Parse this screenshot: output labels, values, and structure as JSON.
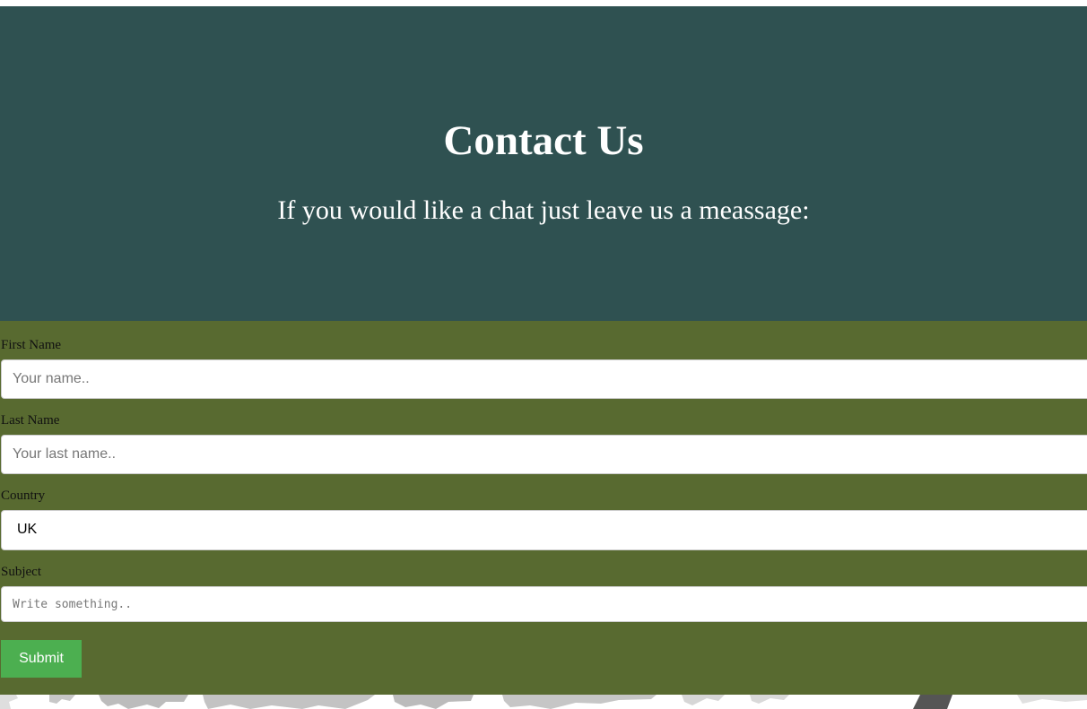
{
  "hero": {
    "title": "Contact Us",
    "subtitle": "If you would like a chat just leave us a meassage:",
    "background_color": "#2f5151"
  },
  "form": {
    "background_color": "#586a30",
    "first_name": {
      "label": "First Name",
      "placeholder": "Your name.."
    },
    "last_name": {
      "label": "Last Name",
      "placeholder": "Your last name.."
    },
    "country": {
      "label": "Country",
      "selected_value": "UK"
    },
    "subject": {
      "label": "Subject",
      "placeholder": "Write something.."
    },
    "submit": {
      "label": "Submit",
      "color": "#4caf50"
    }
  },
  "background_image": {
    "name": "gray-decorative-artwork"
  }
}
